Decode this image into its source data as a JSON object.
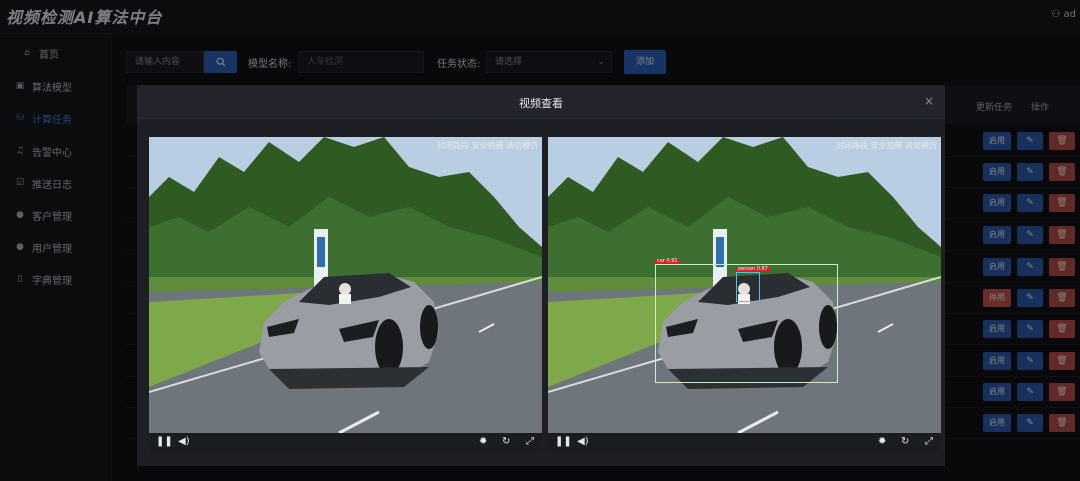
{
  "app": {
    "title": "视频检测AI算法中台",
    "user": "ad"
  },
  "sidebar": {
    "items": [
      {
        "label": "首页",
        "icon": "home-icon"
      },
      {
        "label": "算法模型",
        "icon": "box-icon"
      },
      {
        "label": "计算任务",
        "icon": "database-icon",
        "active": true
      },
      {
        "label": "告警中心",
        "icon": "bell-icon"
      },
      {
        "label": "推送日志",
        "icon": "log-icon"
      },
      {
        "label": "客户管理",
        "icon": "customer-icon"
      },
      {
        "label": "用户管理",
        "icon": "user-icon"
      },
      {
        "label": "字典管理",
        "icon": "dictionary-icon"
      }
    ]
  },
  "filters": {
    "search_placeholder": "请输入内容",
    "model_label": "模型名称:",
    "model_placeholder": "人车检测",
    "status_label": "任务状态:",
    "status_placeholder": "请选择",
    "add_button": "添加"
  },
  "table": {
    "headers": {
      "update_time": "更新任务",
      "actions": "操作"
    },
    "rows": [
      {
        "status_action": "启用"
      },
      {
        "status_action": "启用"
      },
      {
        "status_action": "启用"
      },
      {
        "status_action": "启用"
      },
      {
        "status_action": "启用"
      },
      {
        "status_action": "停用"
      },
      {
        "status_action": "启用"
      },
      {
        "status_action": "启用"
      },
      {
        "status_action": "启用"
      },
      {
        "status_action": "启用"
      }
    ]
  },
  "modal": {
    "title": "视频查看",
    "close_symbol": "×",
    "watermark": "封闭路段 安全拍摄 请勿模仿",
    "detection_labels": {
      "car": "car 0.91",
      "person": "person 0.87"
    }
  },
  "colors": {
    "accent": "#2a5fb6",
    "danger": "#b34d48",
    "active_nav": "#3f7ddb",
    "sky": "#b9cde3",
    "car": "#9a9da3"
  }
}
